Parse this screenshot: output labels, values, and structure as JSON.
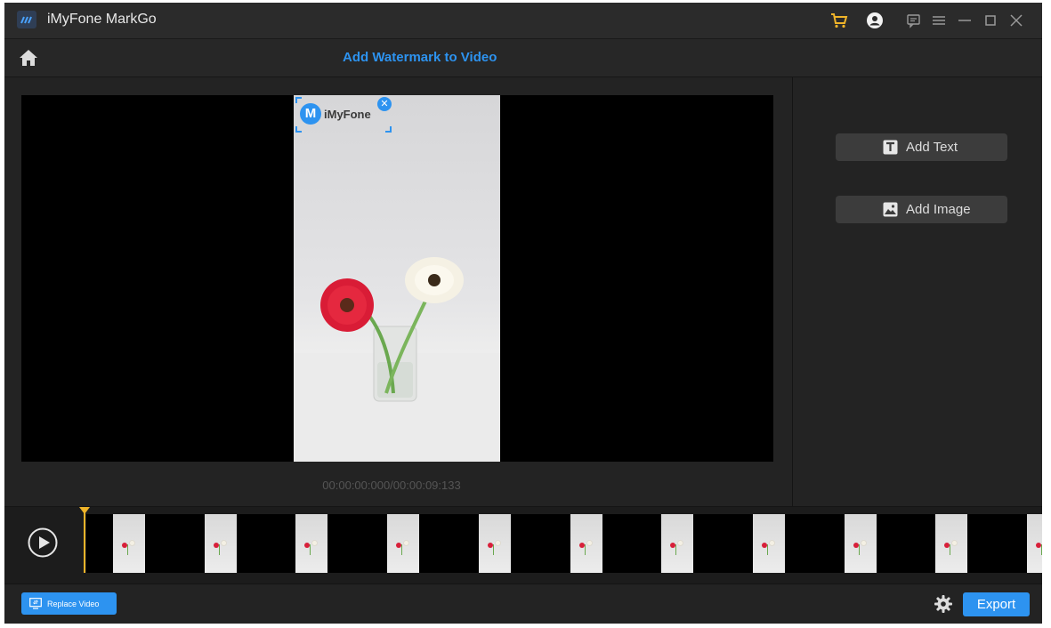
{
  "window": {
    "title": "iMyFone MarkGo",
    "controls": [
      "cart-icon",
      "account-icon",
      "feedback-icon",
      "menu-icon",
      "minimize-icon",
      "maximize-icon",
      "close-icon"
    ]
  },
  "header": {
    "title": "Add Watermark to Video",
    "home_icon": "home-icon"
  },
  "preview": {
    "watermark_text": "iMyFone",
    "watermark_logo_letter": "M",
    "timecode": "00:00:00:000/00:00:09:133"
  },
  "sidebar": {
    "add_text_label": "Add Text",
    "add_image_label": "Add Image"
  },
  "timeline": {
    "thumbnail_count": 11,
    "playhead_position": 0
  },
  "bottom": {
    "replace_label": "Replace Video",
    "export_label": "Export"
  },
  "colors": {
    "accent": "#2d93f0",
    "playhead": "#f0b429",
    "cart": "#f0b429",
    "background": "#232323"
  }
}
